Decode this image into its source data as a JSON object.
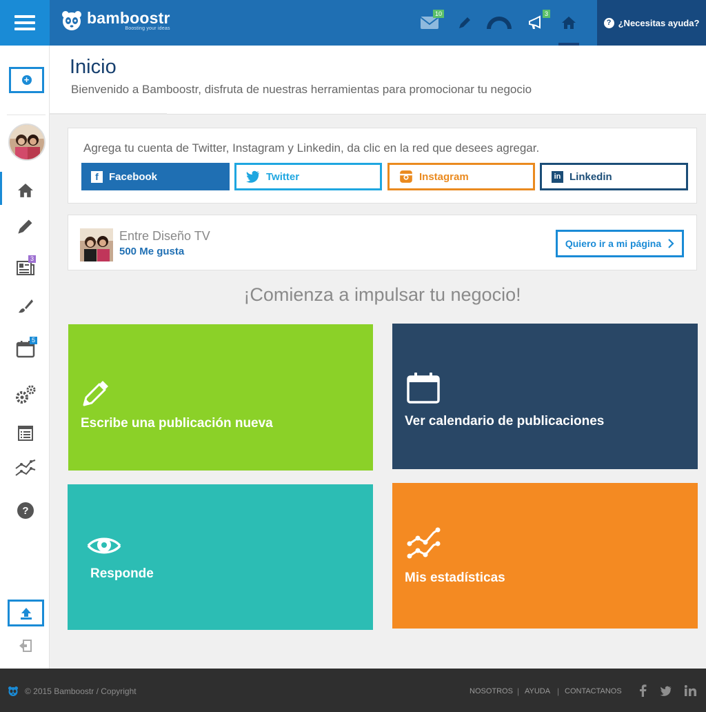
{
  "colors": {
    "topbar": "#1f6fb3",
    "menu_button": "#1a8bd6",
    "help_bg": "#17497f",
    "facebook": "#1f6fb3",
    "twitter": "#1ea6e0",
    "instagram": "#ea8a1f",
    "linkedin": "#1b4d77",
    "tile_write": "#8bd128",
    "tile_calendar": "#294766",
    "tile_respond": "#2cbdb4",
    "tile_stats": "#f48a22",
    "footer": "#2f2f2f"
  },
  "header": {
    "brand": "bamboostr",
    "tagline": "Boosting your ideas",
    "messages_badge": "10",
    "announcements_badge": "3",
    "help_label": "¿Necesitas ayuda?",
    "icons": [
      "menu-icon",
      "mail-icon",
      "pencil-icon",
      "gauge-icon",
      "megaphone-icon",
      "home-icon",
      "help-icon"
    ]
  },
  "sidebar": {
    "posts_badge": "3",
    "calendar_badge": "5",
    "icons": [
      "add-icon",
      "home-icon",
      "pencil-icon",
      "news-icon",
      "brush-icon",
      "calendar-icon",
      "gears-icon",
      "list-icon",
      "stats-icon",
      "help-icon",
      "upload-icon",
      "logout-icon"
    ]
  },
  "page": {
    "title": "Inicio",
    "subtitle": "Bienvenido a Bamboostr, disfruta de nuestras herramientas para promocionar tu negocio"
  },
  "social": {
    "prompt": "Agrega tu cuenta de Twitter, Instagram y Linkedin,  da clic en la red que desees agregar.",
    "facebook": "Facebook",
    "twitter": "Twitter",
    "instagram": "Instagram",
    "linkedin": "Linkedin"
  },
  "fanpage": {
    "name": "Entre Diseño TV",
    "likes": "500 Me gusta",
    "button": "Quiero ir a mi página"
  },
  "cta": {
    "heading": "¡Comienza a impulsar tu negocio!",
    "tiles": {
      "write": "Escribe una publicación nueva",
      "calendar": "Ver calendario de publicaciones",
      "respond": "Responde",
      "stats": "Mis estadísticas"
    }
  },
  "footer": {
    "copyright": "© 2015 Bamboostr / Copyright",
    "links": [
      "NOSOTROS",
      "AYUDA",
      "CONTACTANOS"
    ],
    "separator": "|",
    "social_icons": [
      "facebook-icon",
      "twitter-icon",
      "linkedin-icon"
    ]
  }
}
